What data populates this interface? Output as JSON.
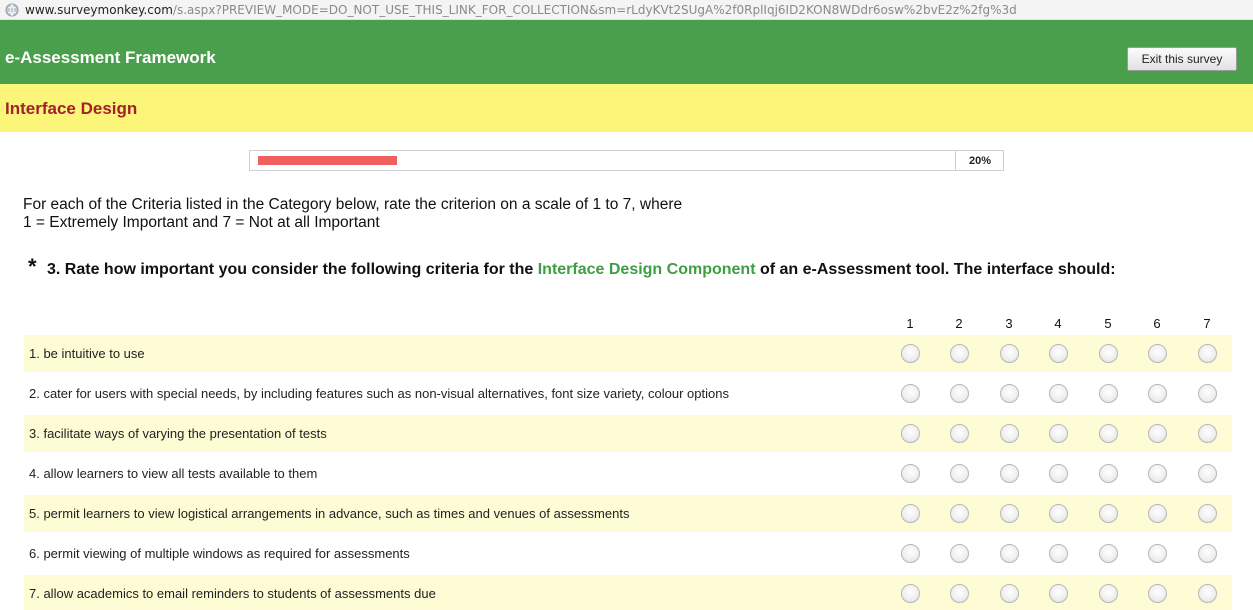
{
  "browser": {
    "url_host": "www.surveymonkey.com",
    "url_path": "/s.aspx?PREVIEW_MODE=DO_NOT_USE_THIS_LINK_FOR_COLLECTION&sm=rLdyKVt2SUgA%2f0RplIqj6ID2KON8WDdr6osw%2bvE2z%2fg%3d"
  },
  "header": {
    "title": "e-Assessment Framework",
    "exit_label": "Exit this survey",
    "color": "#4a9f4c"
  },
  "page": {
    "title": "Interface Design",
    "band_color": "#fbf57a",
    "title_color": "#a41f2a"
  },
  "progress": {
    "percent": 20,
    "label": "20%",
    "fill_color": "#f0605e"
  },
  "instructions": {
    "line1": "For each of the Criteria listed in the Category below, rate the criterion on a scale of 1 to 7, where",
    "line2": "1 = Extremely Important and 7 = Not at all Important"
  },
  "question": {
    "required_marker": "*",
    "prefix": "3. Rate how important you consider the following criteria for the ",
    "highlight": "Interface Design Component",
    "suffix": " of an e-Assessment tool. The interface should:",
    "highlight_color": "#3d9f41"
  },
  "scale": [
    "1",
    "2",
    "3",
    "4",
    "5",
    "6",
    "7"
  ],
  "criteria": [
    "1. be intuitive to use",
    "2. cater for users with special needs, by including features such as non-visual alternatives, font size variety, colour options",
    "3. facilitate ways of varying the presentation of tests",
    "4. allow learners to view all tests available to them",
    "5. permit learners to view logistical arrangements in advance, such as times and venues of assessments",
    "6. permit viewing of multiple windows as required for assessments",
    "7. allow academics to email reminders to students of assessments due"
  ]
}
